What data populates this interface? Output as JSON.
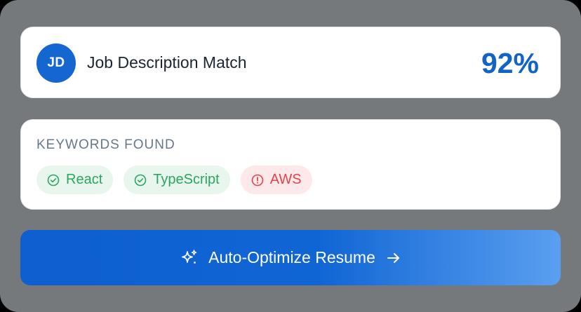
{
  "match": {
    "avatar_initials": "JD",
    "title": "Job Description Match",
    "score": "92%"
  },
  "keywords": {
    "heading": "KEYWORDS FOUND",
    "chips": [
      {
        "label": "React",
        "status": "found",
        "icon": "check-circle-icon"
      },
      {
        "label": "TypeScript",
        "status": "found",
        "icon": "check-circle-icon"
      },
      {
        "label": "AWS",
        "status": "missing",
        "icon": "alert-circle-icon"
      }
    ]
  },
  "action": {
    "label": "Auto-Optimize Resume",
    "leading_icon": "sparkle-icon",
    "trailing_icon": "arrow-right-icon"
  },
  "colors": {
    "accent": "#1263c6",
    "found": "#2aa65f",
    "missing": "#e0444f",
    "backdrop": "#75797c"
  }
}
